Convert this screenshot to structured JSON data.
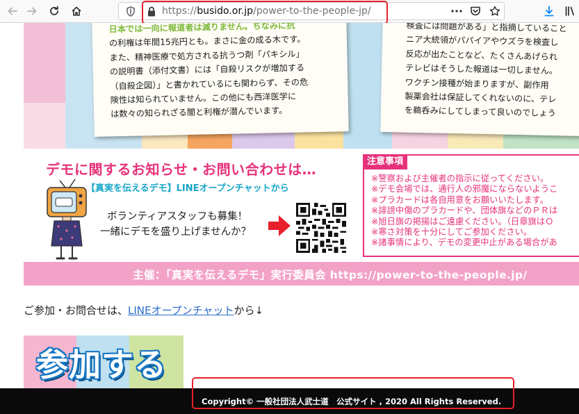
{
  "browser": {
    "url_prefix": "https://",
    "url_host": "busido.or.jp",
    "url_path": "/power-to-the-people-jp/",
    "icons": [
      "back-icon",
      "forward-icon",
      "reload-icon",
      "home-icon",
      "shield-icon",
      "lock-icon",
      "more-icon",
      "pocket-icon",
      "bookmark-star-icon",
      "download-icon",
      "library-icon"
    ]
  },
  "banner_top": {
    "left_lines": [
      "日本では一向に報道者は減りません。ちなみに抗",
      "の利権は年間15兆円とも。まさに金の成る木です。",
      "また、精神医療で処方される抗うつ剤「パキシル」",
      "の説明書（添付文書）には「自殺リスクが増加する",
      "（自殺企図）」と書かれているにも関わらず、その危",
      "険性は知られていません。この他にも西洋医学に",
      "は数々の知られざる闇と利権が潜んでいます。"
    ],
    "right_lines": [
      "検査には問題がある」と指摘していること",
      "ニア大統領がパパイアやウズラを検査し",
      "反応が出たことなど、たくさんあげられ",
      "テレビはそうした報道は一切しません。",
      "ワクチン接種が始まりますが、副作用",
      "製薬会社は保証してくれないのに、テレ",
      "を鵜呑みにしてしまって良いのでしょう"
    ]
  },
  "demo_banner": {
    "heading": "デモに関するお知らせ・お問い合わせは…",
    "subheading": "【真実を伝えるデモ】LINEオープンチャットから",
    "handwritten_1": "ボランティアスタッフも募集！",
    "handwritten_2": "一緒にデモを盛り上げませんか？",
    "notice_title": "注意事項",
    "notice_items": [
      "※警察および主催者の指示に従ってください。",
      "※デモ会場では、通行人の邪魔にならないようこ",
      "※プラカードは各自用意をお願いいたします。",
      "※誹謗中傷のプラカードや、団体旗などのＰＲは",
      "※旭日旗の掲揚はご遠慮ください。（日章旗はＯ",
      "※寒さ対策を十分にしてご参加ください。",
      "※諸事情により、デモの変更中止がある場合があ"
    ],
    "organizer": "主催：「真実を伝えるデモ」実行委員会 https://power-to-the-people.jp/"
  },
  "contact": {
    "prefix": "ご参加・お問合せは、",
    "link": "LINEオープンチャット",
    "suffix": "から↓"
  },
  "join_banner": {
    "label": "参加する"
  },
  "footer": {
    "copyright": "Copyright© 一般社団法人武士道　公式サイト , 2020 All Rights Reserved."
  },
  "colors": {
    "accent_pink": "#e6327a",
    "line_link": "#2a6cc8",
    "annotation_red": "#e8202a",
    "footer_bg": "#0a0a0a"
  }
}
